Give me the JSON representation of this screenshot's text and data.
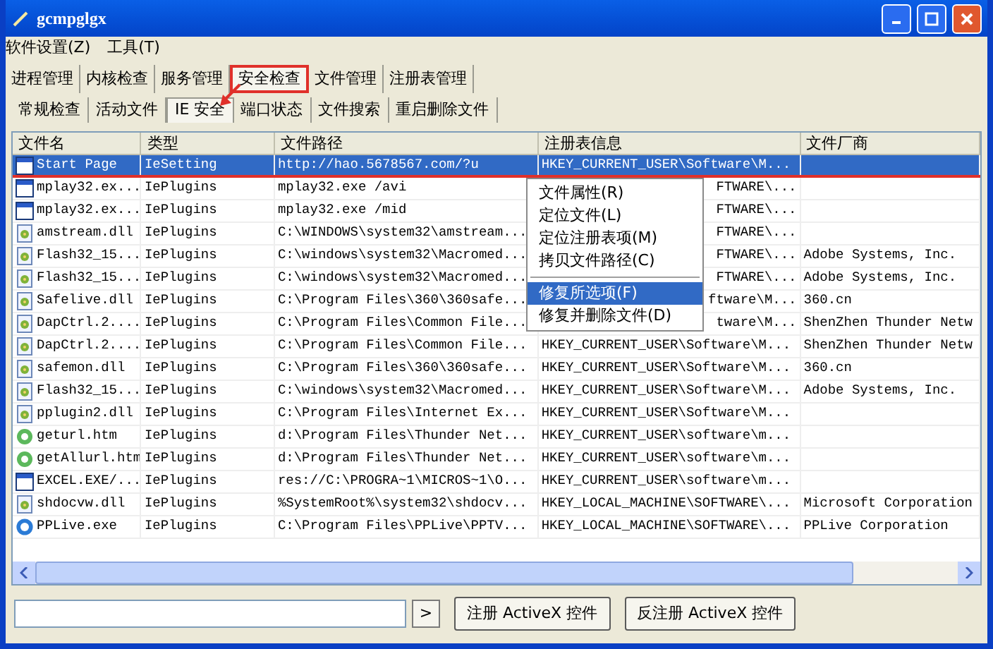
{
  "window": {
    "title": "gcmpglgx"
  },
  "menu": [
    "软件设置(Z)",
    "工具(T)"
  ],
  "main_tabs": [
    {
      "label": "进程管理",
      "selected": false
    },
    {
      "label": "内核检查",
      "selected": false
    },
    {
      "label": "服务管理",
      "selected": false
    },
    {
      "label": "安全检查",
      "selected": true
    },
    {
      "label": "文件管理",
      "selected": false
    },
    {
      "label": "注册表管理",
      "selected": false
    }
  ],
  "sub_tabs": [
    {
      "label": "常规检查",
      "selected": false
    },
    {
      "label": "活动文件",
      "selected": false
    },
    {
      "label": "IE 安全",
      "selected": true
    },
    {
      "label": "端口状态",
      "selected": false
    },
    {
      "label": "文件搜索",
      "selected": false
    },
    {
      "label": "重启删除文件",
      "selected": false
    }
  ],
  "table": {
    "columns": [
      "文件名",
      "类型",
      "文件路径",
      "注册表信息",
      "文件厂商"
    ],
    "rows": [
      {
        "kind": "window",
        "selected": true,
        "under_menu": false,
        "cells": [
          "Start Page",
          "IeSetting",
          "http://hao.5678567.com/?u",
          "HKEY_CURRENT_USER\\Software\\M...",
          ""
        ]
      },
      {
        "kind": "window",
        "selected": false,
        "under_menu": true,
        "cells": [
          "mplay32.ex...",
          "IePlugins",
          "mplay32.exe /avi",
          "FTWARE\\...",
          ""
        ]
      },
      {
        "kind": "window",
        "selected": false,
        "under_menu": true,
        "cells": [
          "mplay32.ex...",
          "IePlugins",
          "mplay32.exe /mid",
          "FTWARE\\...",
          ""
        ]
      },
      {
        "kind": "library",
        "selected": false,
        "under_menu": true,
        "cells": [
          "amstream.dll",
          "IePlugins",
          "C:\\WINDOWS\\system32\\amstream...",
          "FTWARE\\...",
          ""
        ]
      },
      {
        "kind": "library",
        "selected": false,
        "under_menu": true,
        "cells": [
          "Flash32_15...",
          "IePlugins",
          "C:\\windows\\system32\\Macromed...",
          "FTWARE\\...",
          "Adobe Systems, Inc."
        ]
      },
      {
        "kind": "library",
        "selected": false,
        "under_menu": true,
        "cells": [
          "Flash32_15...",
          "IePlugins",
          "C:\\windows\\system32\\Macromed...",
          "FTWARE\\...",
          "Adobe Systems, Inc."
        ]
      },
      {
        "kind": "library",
        "selected": false,
        "under_menu": true,
        "cells": [
          "Safelive.dll",
          "IePlugins",
          "C:\\Program Files\\360\\360safe...",
          "ftware\\M...",
          "360.cn"
        ]
      },
      {
        "kind": "library",
        "selected": false,
        "under_menu": true,
        "cells": [
          "DapCtrl.2....",
          "IePlugins",
          "C:\\Program Files\\Common File...",
          "tware\\M...",
          "ShenZhen Thunder Netw"
        ]
      },
      {
        "kind": "library",
        "selected": false,
        "under_menu": false,
        "cells": [
          "DapCtrl.2....",
          "IePlugins",
          "C:\\Program Files\\Common File...",
          "HKEY_CURRENT_USER\\Software\\M...",
          "ShenZhen Thunder Netw"
        ]
      },
      {
        "kind": "library",
        "selected": false,
        "under_menu": false,
        "cells": [
          "safemon.dll",
          "IePlugins",
          "C:\\Program Files\\360\\360safe...",
          "HKEY_CURRENT_USER\\Software\\M...",
          "360.cn"
        ]
      },
      {
        "kind": "library",
        "selected": false,
        "under_menu": false,
        "cells": [
          "Flash32_15...",
          "IePlugins",
          "C:\\windows\\system32\\Macromed...",
          "HKEY_CURRENT_USER\\Software\\M...",
          "Adobe Systems, Inc."
        ]
      },
      {
        "kind": "library",
        "selected": false,
        "under_menu": false,
        "cells": [
          "pplugin2.dll",
          "IePlugins",
          "C:\\Program Files\\Internet Ex...",
          "HKEY_CURRENT_USER\\Software\\M...",
          ""
        ]
      },
      {
        "kind": "web",
        "selected": false,
        "under_menu": false,
        "cells": [
          "geturl.htm",
          "IePlugins",
          "d:\\Program Files\\Thunder Net...",
          "HKEY_CURRENT_USER\\software\\m...",
          ""
        ]
      },
      {
        "kind": "web",
        "selected": false,
        "under_menu": false,
        "cells": [
          "getAllurl.htm",
          "IePlugins",
          "d:\\Program Files\\Thunder Net...",
          "HKEY_CURRENT_USER\\software\\m...",
          ""
        ]
      },
      {
        "kind": "window",
        "selected": false,
        "under_menu": false,
        "cells": [
          "EXCEL.EXE/...",
          "IePlugins",
          "res://C:\\PROGRA~1\\MICROS~1\\O...",
          "HKEY_CURRENT_USER\\software\\m...",
          ""
        ]
      },
      {
        "kind": "library",
        "selected": false,
        "under_menu": false,
        "cells": [
          "shdocvw.dll",
          "IePlugins",
          "%SystemRoot%\\system32\\shdocv...",
          "HKEY_LOCAL_MACHINE\\SOFTWARE\\...",
          "Microsoft Corporation"
        ]
      },
      {
        "kind": "circle",
        "selected": false,
        "under_menu": false,
        "cells": [
          "PPLive.exe",
          "IePlugins",
          "C:\\Program Files\\PPLive\\PPTV...",
          "HKEY_LOCAL_MACHINE\\SOFTWARE\\...",
          "PPLive Corporation"
        ]
      }
    ]
  },
  "context_menu": [
    {
      "label": "文件属性(R)",
      "selected": false
    },
    {
      "label": "定位文件(L)",
      "selected": false
    },
    {
      "label": "定位注册表项(M)",
      "selected": false
    },
    {
      "label": "拷贝文件路径(C)",
      "selected": false,
      "separator_after": true
    },
    {
      "label": "修复所选项(F)",
      "selected": true
    },
    {
      "label": "修复并删除文件(D)",
      "selected": false
    }
  ],
  "command": {
    "go": ">"
  },
  "buttons": [
    "注册 ActiveX 控件",
    "反注册 ActiveX 控件"
  ]
}
